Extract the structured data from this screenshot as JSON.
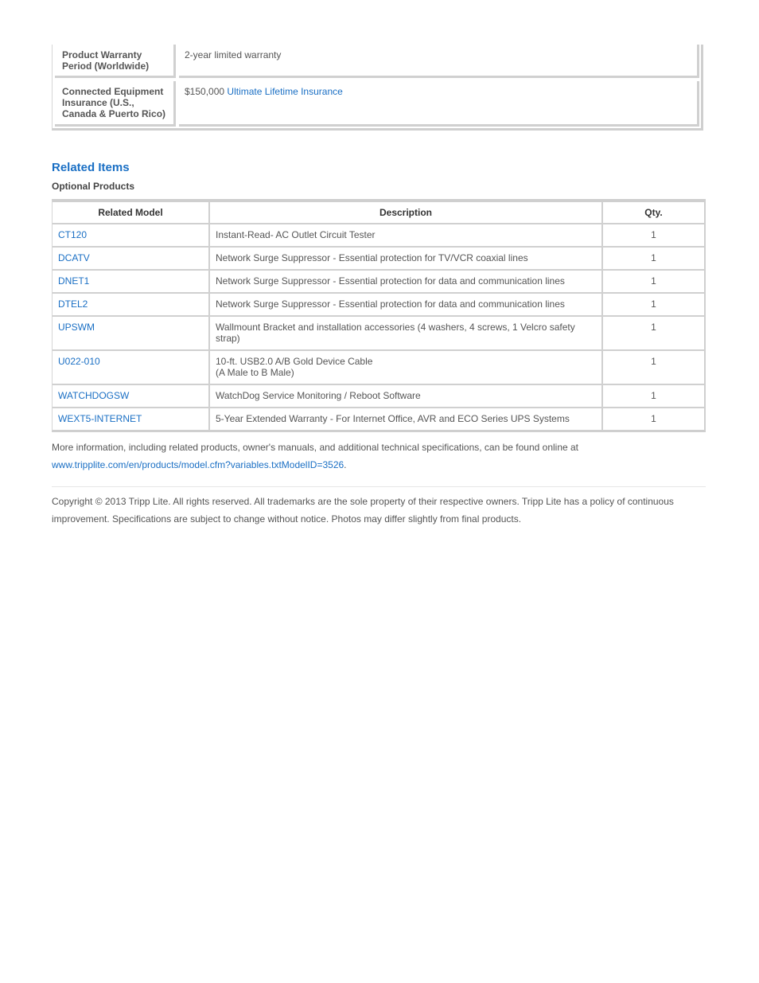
{
  "spec_table": {
    "rows": [
      {
        "label": "Product Warranty Period (Worldwide)",
        "value": "2-year limited warranty",
        "link": ""
      },
      {
        "label": "Connected Equipment Insurance (U.S., Canada & Puerto Rico)",
        "value": "$150,000",
        "link": "Ultimate Lifetime Insurance"
      }
    ]
  },
  "related": {
    "title": "Related Items",
    "subtitle": "Optional Products",
    "headers": {
      "model": "Related Model",
      "description": "Description",
      "qty": "Qty."
    },
    "rows": [
      {
        "model": "CT120",
        "description": "Instant-Read- AC Outlet Circuit Tester",
        "description2": "",
        "qty": "1"
      },
      {
        "model": "DCATV",
        "description": "Network Surge Suppressor - Essential protection for TV/VCR coaxial lines",
        "description2": "",
        "qty": "1"
      },
      {
        "model": "DNET1",
        "description": "Network Surge Suppressor - Essential protection for data and communication lines",
        "description2": "",
        "qty": "1"
      },
      {
        "model": "DTEL2",
        "description": "Network Surge Suppressor - Essential protection for data and communication lines",
        "description2": "",
        "qty": "1"
      },
      {
        "model": "UPSWM",
        "description": "Wallmount Bracket and installation accessories (4 washers, 4 screws, 1 Velcro safety strap)",
        "description2": "",
        "qty": "1"
      },
      {
        "model": "U022-010",
        "description": "10-ft. USB2.0 A/B Gold Device Cable",
        "description2": "(A Male to B Male)",
        "qty": "1"
      },
      {
        "model": "WATCHDOGSW",
        "description": "WatchDog Service Monitoring / Reboot Software",
        "description2": "",
        "qty": "1"
      },
      {
        "model": "WEXT5-INTERNET",
        "description": "5-Year Extended Warranty - For Internet Office, AVR and ECO Series UPS Systems",
        "description2": "",
        "qty": "1"
      }
    ]
  },
  "more_info": {
    "text": "More information, including related products, owner's manuals, and additional technical specifications, can be found online at",
    "link": "www.tripplite.com/en/products/model.cfm?variables.txtModelID=3526",
    "suffix": "."
  },
  "copyright": "Copyright © 2013 Tripp Lite. All rights reserved. All trademarks are the sole property of their respective owners. Tripp Lite has a policy of continuous improvement. Specifications are subject to change without notice. Photos may differ slightly from final products.",
  "colors": {
    "link": "#1a6fc4",
    "text": "#555555",
    "border": "#d0d0d0"
  }
}
